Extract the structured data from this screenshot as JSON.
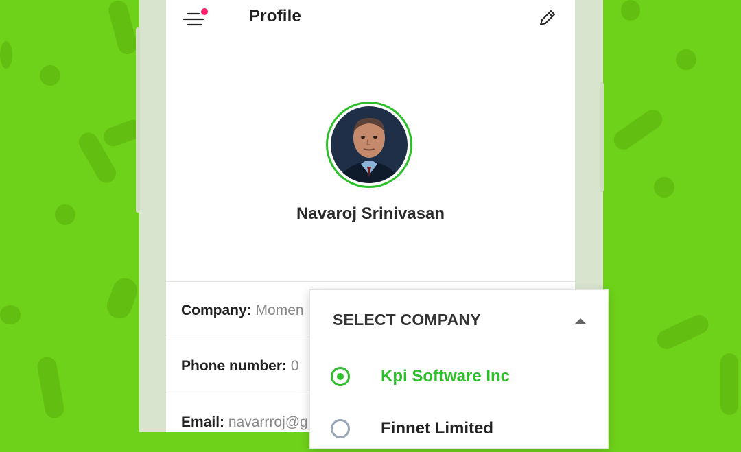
{
  "app": {
    "title": "Profile"
  },
  "profile": {
    "name": "Navaroj Srinivasan"
  },
  "info": {
    "company": {
      "label": "Company:",
      "value": "Momen"
    },
    "phone": {
      "label": "Phone number:",
      "value": "0"
    },
    "email": {
      "label": "Email:",
      "value": "navarrroj@g"
    }
  },
  "dropdown": {
    "header": "SELECT COMPANY",
    "options": [
      {
        "label": "Kpi Software Inc",
        "selected": true
      },
      {
        "label": "Finnet Limited",
        "selected": false
      }
    ]
  },
  "icons": {
    "menu": "menu-icon",
    "edit": "pencil-icon",
    "toggle": "caret-up-icon"
  },
  "colors": {
    "background": "#6fd21a",
    "accent": "#2dbf2a",
    "notification": "#ff1f6b"
  }
}
